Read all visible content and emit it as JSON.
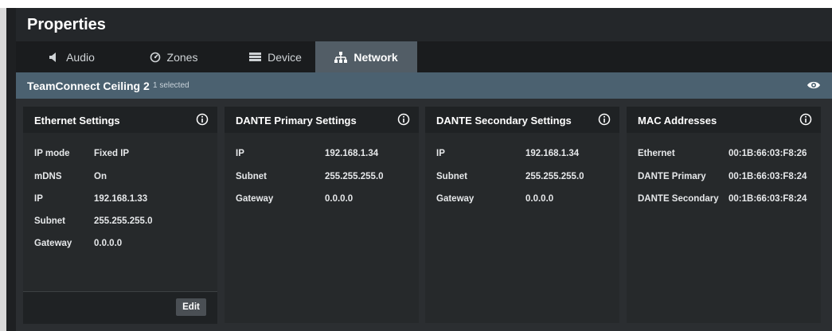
{
  "window": {
    "title": "Properties"
  },
  "tabs": [
    {
      "label": "Audio",
      "icon": "speaker-icon"
    },
    {
      "label": "Zones",
      "icon": "gauge-icon"
    },
    {
      "label": "Device",
      "icon": "device-icon"
    },
    {
      "label": "Network",
      "icon": "network-icon",
      "active": true
    }
  ],
  "device": {
    "name": "TeamConnect Ceiling 2",
    "selected": "1 selected"
  },
  "panels": {
    "ethernet": {
      "title": "Ethernet Settings",
      "rows": [
        {
          "label": "IP mode",
          "value": "Fixed IP"
        },
        {
          "label": "mDNS",
          "value": "On"
        },
        {
          "label": "IP",
          "value": "192.168.1.33"
        },
        {
          "label": "Subnet",
          "value": "255.255.255.0"
        },
        {
          "label": "Gateway",
          "value": "0.0.0.0"
        }
      ],
      "edit_label": "Edit"
    },
    "dante_primary": {
      "title": "DANTE Primary Settings",
      "rows": [
        {
          "label": "IP",
          "value": "192.168.1.34"
        },
        {
          "label": "Subnet",
          "value": "255.255.255.0"
        },
        {
          "label": "Gateway",
          "value": "0.0.0.0"
        }
      ]
    },
    "dante_secondary": {
      "title": "DANTE Secondary Settings",
      "rows": [
        {
          "label": "IP",
          "value": "192.168.1.34"
        },
        {
          "label": "Subnet",
          "value": "255.255.255.0"
        },
        {
          "label": "Gateway",
          "value": "0.0.0.0"
        }
      ]
    },
    "mac": {
      "title": "MAC Addresses",
      "rows": [
        {
          "label": "Ethernet",
          "value": "00:1B:66:03:F8:26"
        },
        {
          "label": "DANTE Primary",
          "value": "00:1B:66:03:F8:24"
        },
        {
          "label": "DANTE Secondary",
          "value": "00:1B:66:03:F8:24"
        }
      ]
    }
  },
  "colors": {
    "background": "#2b2e31",
    "titlebar": "#24272a",
    "tabbar": "#1a1c1e",
    "active_tab": "#525d66",
    "device_bar": "#4b6170",
    "panel": "#26292b",
    "panel_header": "#1f2224"
  }
}
